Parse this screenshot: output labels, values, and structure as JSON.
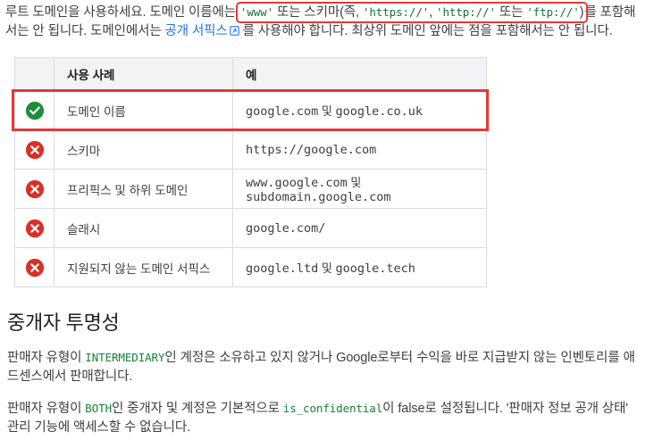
{
  "intro": {
    "part1": "루트 도메인을 사용하세요. 도메인 이름에는 ",
    "highlight": {
      "www": "'www'",
      "mid1": " 또는 스키마(즉, ",
      "https": "'https://'",
      "comma1": ", ",
      "http": "'http://'",
      "mid2": " 또는 ",
      "ftp": "'ftp://'",
      "close": ")"
    },
    "part2": "를 포함해서는 안 됩니다. 도메인에서는 ",
    "link_text": "공개 서픽스",
    "link_icon": "external-link-icon",
    "part3": " 를 사용해야 합니다. 최상위 도메인 앞에는 점을 포함해서는 안 됩니다."
  },
  "table": {
    "headers": {
      "icon": "",
      "use_case": "사용 사례",
      "example": "예"
    },
    "rows": [
      {
        "status": "check",
        "status_icon": "check-circle-icon",
        "use_case": "도메인 이름",
        "example_pre": "google.com",
        "example_amp": " 및 ",
        "example_post": "google.co.uk",
        "highlighted": true
      },
      {
        "status": "cross",
        "status_icon": "cross-circle-icon",
        "use_case": "스키마",
        "example_pre": "https://google.com",
        "example_amp": "",
        "example_post": "",
        "highlighted": false
      },
      {
        "status": "cross",
        "status_icon": "cross-circle-icon",
        "use_case": "프리픽스 및 하위 도메인",
        "example_pre": "www.google.com",
        "example_amp": " 및 ",
        "example_post": "subdomain.google.com",
        "highlighted": false
      },
      {
        "status": "cross",
        "status_icon": "cross-circle-icon",
        "use_case": "슬래시",
        "example_pre": "google.com/",
        "example_amp": "",
        "example_post": "",
        "highlighted": false
      },
      {
        "status": "cross",
        "status_icon": "cross-circle-icon",
        "use_case": "지원되지 않는 도메인 서픽스",
        "example_pre": "google.ltd",
        "example_amp": " 및 ",
        "example_post": "google.tech",
        "highlighted": false
      }
    ]
  },
  "section": {
    "heading": "중개자 투명성",
    "paragraph1": {
      "part1": "판매자 유형이 ",
      "code1": "INTERMEDIARY",
      "part2": "인 계정은 소유하고 있지 않거나 Google로부터 수익을 바로 지급받지 않는 인벤토리를 애드센스에서 판매합니다."
    },
    "paragraph2": {
      "part1": "판매자 유형이 ",
      "code1": "BOTH",
      "part2": "인 중개자 및 계정은 기본적으로 ",
      "code2": "is_confidential",
      "part3": "이 false로 설정됩니다. '판매자 정보 공개 상태' 관리 기능에 액세스할 수 없습니다."
    }
  },
  "colors": {
    "success_green": "#1e8e3e",
    "error_red": "#d93025",
    "highlight_red": "#e53935",
    "code_green": "#188038",
    "link_blue": "#1a73e8",
    "header_bg": "#f1f3f4",
    "border": "#dadce0"
  }
}
